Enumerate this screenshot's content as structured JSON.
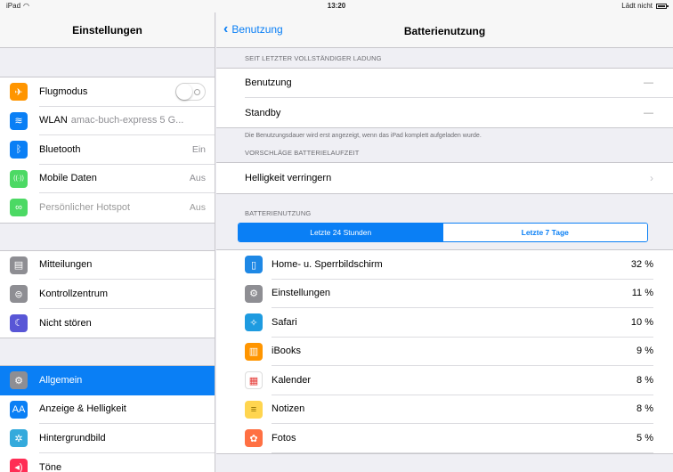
{
  "statusbar": {
    "device": "iPad",
    "time": "13:20",
    "charging": "Lädt nicht"
  },
  "left": {
    "title": "Einstellungen",
    "group1": [
      {
        "label": "Flugmodus",
        "icon": "airplane-icon",
        "color": "#ff9500",
        "glyph": "✈",
        "control": "toggle"
      },
      {
        "label": "WLAN",
        "sub": "amac-buch-express 5 G...",
        "icon": "wifi-icon",
        "color": "#0a7ff5",
        "glyph": "≋"
      },
      {
        "label": "Bluetooth",
        "value": "Ein",
        "icon": "bluetooth-icon",
        "color": "#0a7ff5",
        "glyph": "ᛒ"
      },
      {
        "label": "Mobile Daten",
        "value": "Aus",
        "icon": "antenna-icon",
        "color": "#4cd964",
        "glyph": "((·))"
      },
      {
        "label": "Persönlicher Hotspot",
        "value": "Aus",
        "icon": "hotspot-icon",
        "color": "#4cd964",
        "glyph": "∞",
        "dim": true
      }
    ],
    "group2": [
      {
        "label": "Mitteilungen",
        "icon": "notifications-icon",
        "color": "#8e8e93",
        "glyph": "▤"
      },
      {
        "label": "Kontrollzentrum",
        "icon": "control-center-icon",
        "color": "#8e8e93",
        "glyph": "⊜"
      },
      {
        "label": "Nicht stören",
        "icon": "moon-icon",
        "color": "#5856d6",
        "glyph": "☾"
      }
    ],
    "group3": [
      {
        "label": "Allgemein",
        "icon": "gear-icon",
        "color": "#8e8e93",
        "glyph": "⚙",
        "selected": true
      },
      {
        "label": "Anzeige & Helligkeit",
        "icon": "display-icon",
        "color": "#0a7ff5",
        "glyph": "AA"
      },
      {
        "label": "Hintergrundbild",
        "icon": "wallpaper-icon",
        "color": "#34aadc",
        "glyph": "✲"
      },
      {
        "label": "Töne",
        "icon": "speaker-icon",
        "color": "#ff2d55",
        "glyph": "◂)"
      }
    ]
  },
  "right": {
    "back_label": "Benutzung",
    "title": "Batterienutzung",
    "section1_header": "SEIT LETZTER VOLLSTÄNDIGER LADUNG",
    "usage_label": "Benutzung",
    "usage_value": "—",
    "standby_label": "Standby",
    "standby_value": "—",
    "note": "Die Benutzungsdauer wird erst angezeigt, wenn das iPad komplett aufgeladen wurde.",
    "section2_header": "VORSCHLÄGE BATTERIELAUFZEIT",
    "suggestion_label": "Helligkeit verringern",
    "section3_header": "BATTERIENUTZUNG",
    "segments": [
      "Letzte 24 Stunden",
      "Letzte 7 Tage"
    ],
    "apps": [
      {
        "name": "Home- u. Sperrbildschirm",
        "percent": "32 %",
        "icon": "phone-screen-icon",
        "color": "#1e88e5",
        "glyph": "▯"
      },
      {
        "name": "Einstellungen",
        "percent": "11 %",
        "icon": "gear-icon",
        "color": "#8e8e93",
        "glyph": "⚙"
      },
      {
        "name": "Safari",
        "percent": "10 %",
        "icon": "safari-compass-icon",
        "color": "#1e9be0",
        "glyph": "✧"
      },
      {
        "name": "iBooks",
        "percent": "9 %",
        "icon": "book-icon",
        "color": "#ff9500",
        "glyph": "▥"
      },
      {
        "name": "Kalender",
        "percent": "8 %",
        "icon": "calendar-icon",
        "color": "#ffffff",
        "glyph": "▦"
      },
      {
        "name": "Notizen",
        "percent": "8 %",
        "icon": "notes-icon",
        "color": "#ffd54f",
        "glyph": "≡"
      },
      {
        "name": "Fotos",
        "percent": "5 %",
        "icon": "photos-flower-icon",
        "color": "#ff7043",
        "glyph": "✿"
      }
    ]
  }
}
